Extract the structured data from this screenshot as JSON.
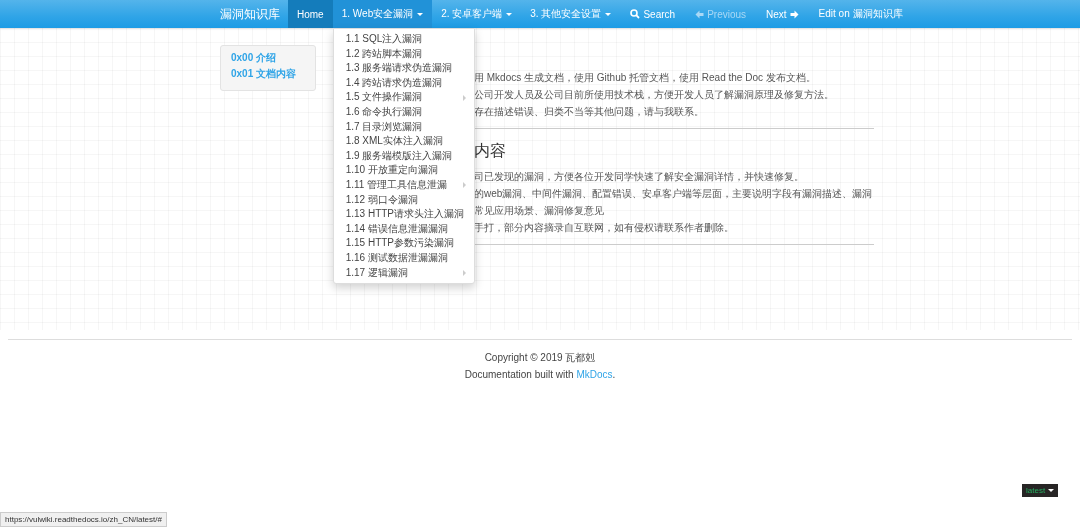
{
  "navbar": {
    "brand": "漏洞知识库",
    "items": [
      {
        "label": "Home",
        "selected": true,
        "has_caret": false,
        "expanded": false
      },
      {
        "label": "1. Web安全漏洞",
        "selected": false,
        "has_caret": true,
        "expanded": true,
        "menu": [
          {
            "label": "1.1 SQL注入漏洞",
            "has_submenu": false
          },
          {
            "label": "1.2 跨站脚本漏洞",
            "has_submenu": false
          },
          {
            "label": "1.3 服务端请求伪造漏洞",
            "has_submenu": false
          },
          {
            "label": "1.4 跨站请求伪造漏洞",
            "has_submenu": false
          },
          {
            "label": "1.5 文件操作漏洞",
            "has_submenu": true
          },
          {
            "label": "1.6 命令执行漏洞",
            "has_submenu": false
          },
          {
            "label": "1.7 目录浏览漏洞",
            "has_submenu": false
          },
          {
            "label": "1.8 XML实体注入漏洞",
            "has_submenu": false
          },
          {
            "label": "1.9 服务端模版注入漏洞",
            "has_submenu": false
          },
          {
            "label": "1.10 开放重定向漏洞",
            "has_submenu": false
          },
          {
            "label": "1.11 管理工具信息泄漏",
            "has_submenu": true
          },
          {
            "label": "1.12 弱口令漏洞",
            "has_submenu": false
          },
          {
            "label": "1.13 HTTP请求头注入漏洞",
            "has_submenu": false
          },
          {
            "label": "1.14 错误信息泄漏漏洞",
            "has_submenu": false
          },
          {
            "label": "1.15 HTTP参数污染漏洞",
            "has_submenu": false
          },
          {
            "label": "1.16 测试数据泄漏漏洞",
            "has_submenu": false
          },
          {
            "label": "1.17 逻辑漏洞",
            "has_submenu": true
          }
        ]
      },
      {
        "label": "2. 安卓客户端",
        "selected": false,
        "has_caret": true,
        "expanded": false
      },
      {
        "label": "3. 其他安全设置",
        "selected": false,
        "has_caret": true,
        "expanded": false
      }
    ],
    "right_items": [
      {
        "kind": "search",
        "label": "Search",
        "disabled": false
      },
      {
        "kind": "previous",
        "label": "Previous",
        "disabled": true
      },
      {
        "kind": "next",
        "label": "Next",
        "disabled": false
      },
      {
        "kind": "edit",
        "label": "Edit on 漏洞知识库",
        "disabled": false
      }
    ]
  },
  "sidebar": {
    "items": [
      {
        "label": "0x00 介绍"
      },
      {
        "label": "0x01 文档内容"
      }
    ]
  },
  "content": {
    "sections": [
      {
        "paragraphs": [
          "用 Mkdocs 生成文档，使用 Github 托管文档，使用 Read the Doc 发布文档。",
          "公司开发人员及公司目前所使用技术栈，方便开发人员了解漏洞原理及修复方法。",
          "存在描述错误、归类不当等其他问题，请与我联系。"
        ]
      },
      {
        "heading": "内容",
        "paragraphs": [
          "司已发现的漏洞，方便各位开发同学快速了解安全漏洞详情，并快速修复。",
          "的web漏洞、中间件漏洞、配置错误、安卓客户端等层面，主要说明字段有漏洞描述、漏洞常见应用场景、漏洞修复意见",
          "手打，部分内容摘录自互联网，如有侵权请联系作者删除。"
        ]
      }
    ]
  },
  "footer": {
    "copyright": "Copyright © 2019 瓦都剋",
    "built_with": "Documentation built with",
    "link": "MkDocs",
    "link_end": "."
  },
  "version_badge": {
    "label": "latest"
  },
  "status_url": "https://vulwiki.readthedocs.io/zh_CN/latest/#"
}
